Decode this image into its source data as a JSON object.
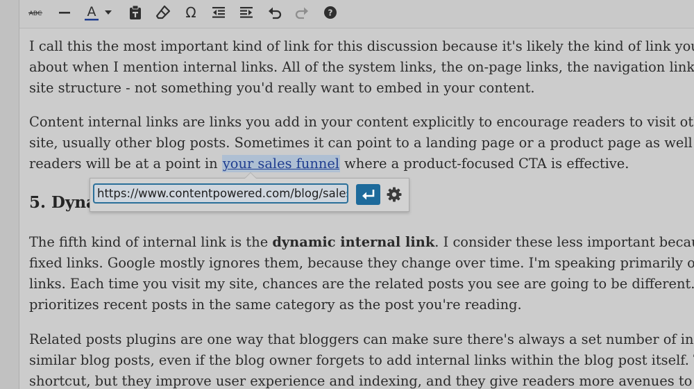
{
  "toolbar": {
    "strikethrough_label": "ABC",
    "text_color_label": "A",
    "text_color_swatch": "#1f3d8f"
  },
  "content": {
    "p1": [
      "I call this the most important kind of link for this discussion because it's likely the kind of link you're thinking",
      "about when I mention internal links. All of the system links, the on-page links, the navigation links are part o",
      "site structure - not something you'd really want to embed in your content."
    ],
    "p2": {
      "line1": "Content internal links are links you add in your content explicitly to encourage readers to visit other parts of y",
      "line2": "site, usually other blog posts. Sometimes it can point to a landing page or a product page as well if you think",
      "line3_before": "readers will be at a point in ",
      "link_text": "your sales funnel",
      "line3_after": " where a product-focused CTA is effective."
    },
    "heading": "5. Dyna",
    "p3": {
      "line1_before": "The fifth kind of internal link is the ",
      "line1_bold": "dynamic internal link",
      "line1_after": ". I consider these less important because they ar",
      "line2": "fixed links. Google mostly ignores them, because they change over time. I'm speaking primarily of the related",
      "line3": "links. Each time you visit my site, chances are the related posts you see are going to be different. That's becau",
      "line4": "prioritizes recent posts in the same category as the post you're reading."
    },
    "p4": [
      "Related posts plugins are one way that bloggers can make sure there's always a set number of internal links to",
      "similar blog posts, even if the blog owner forgets to add internal links within the blog post itself. They're a bit",
      "shortcut, but they improve user experience and indexing, and they give readers more avenues to stay around."
    ]
  },
  "link_popup": {
    "url_value": "https://www.contentpowered.com/blog/sales-f",
    "apply_icon": "enter-icon",
    "settings_icon": "gear-icon"
  },
  "colors": {
    "link": "#1f3d8f",
    "selection": "#aebfd3",
    "accent_button": "#1d6a9b",
    "icon": "#2f2f2f",
    "icon_disabled": "#8e8e8e"
  }
}
